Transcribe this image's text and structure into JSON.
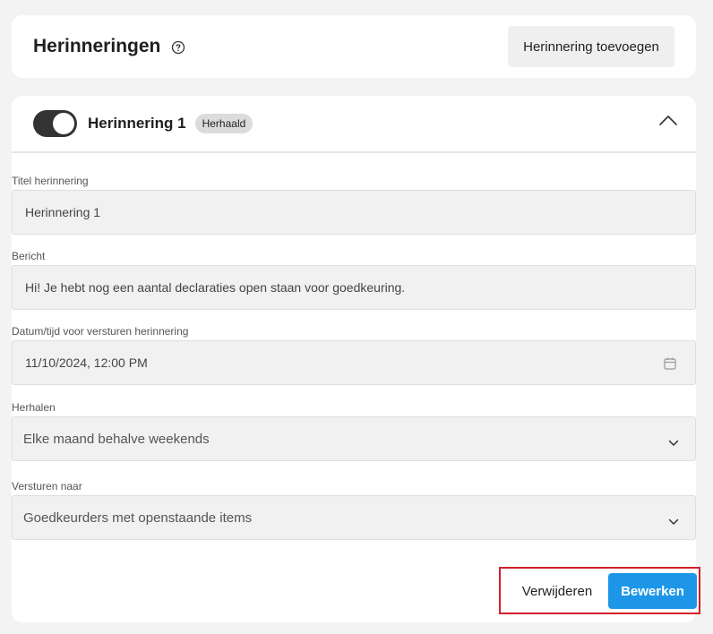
{
  "header": {
    "title": "Herinneringen",
    "add_button_label": "Herinnering toevoegen"
  },
  "reminder": {
    "enabled": true,
    "name": "Herinnering 1",
    "badge": "Herhaald",
    "fields": {
      "title": {
        "label": "Titel herinnering",
        "value": "Herinnering 1"
      },
      "message": {
        "label": "Bericht",
        "value": "Hi! Je hebt nog een aantal declaraties open staan voor goedkeuring."
      },
      "datetime": {
        "label": "Datum/tijd voor versturen herinnering",
        "value": "11/10/2024, 12:00 PM"
      },
      "repeat": {
        "label": "Herhalen",
        "value": "Elke maand behalve weekends"
      },
      "send_to": {
        "label": "Versturen naar",
        "value": "Goedkeurders met openstaande items"
      }
    },
    "actions": {
      "delete_label": "Verwijderen",
      "edit_label": "Bewerken"
    }
  },
  "colors": {
    "primary": "#1e96e8",
    "toggle_on": "#333333",
    "highlight_border": "#d21f2a"
  },
  "icons": {
    "help": "help-circle-icon",
    "collapse": "chevron-up-icon",
    "calendar": "calendar-icon",
    "dropdown": "chevron-down-icon"
  }
}
